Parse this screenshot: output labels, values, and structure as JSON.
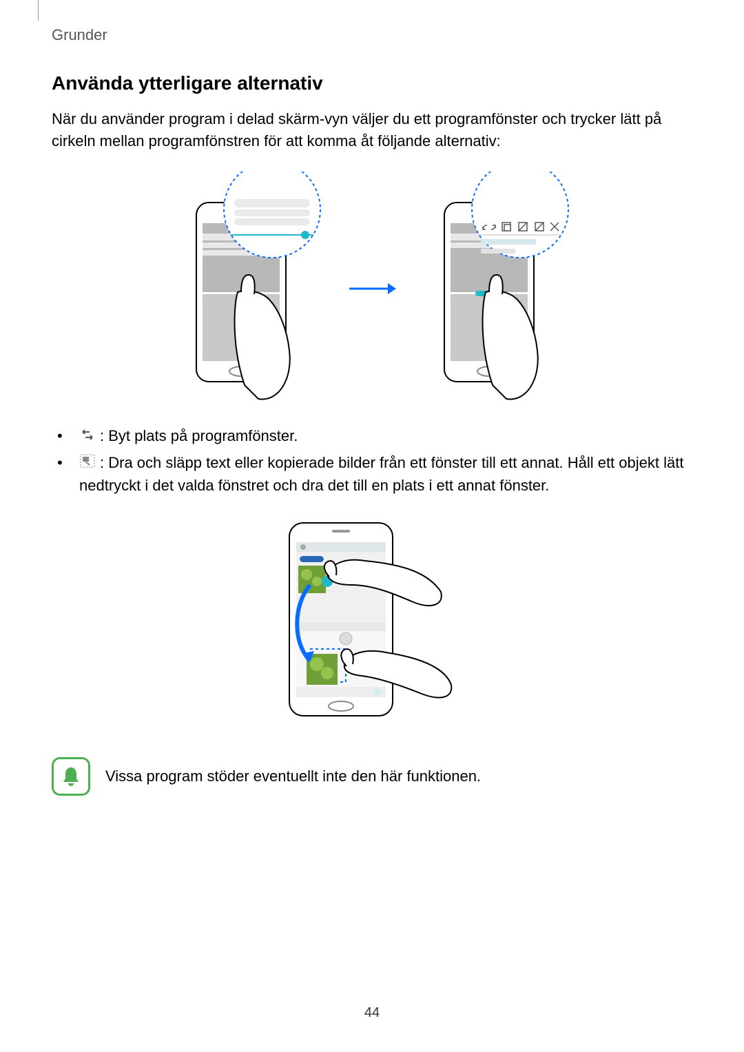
{
  "header": {
    "section": "Grunder"
  },
  "section_title": "Använda ytterligare alternativ",
  "intro": "När du använder program i delad skärm-vyn väljer du ett programfönster och trycker lätt på cirkeln mellan programfönstren för att komma åt följande alternativ:",
  "bullets": {
    "swap": ": Byt plats på programfönster.",
    "drag": ": Dra och släpp text eller kopierade bilder från ett fönster till ett annat. Håll ett objekt lätt nedtryckt i det valda fönstret och dra det till en plats i ett annat fönster."
  },
  "note": "Vissa program stöder eventuellt inte den här funktionen.",
  "page_number": "44"
}
